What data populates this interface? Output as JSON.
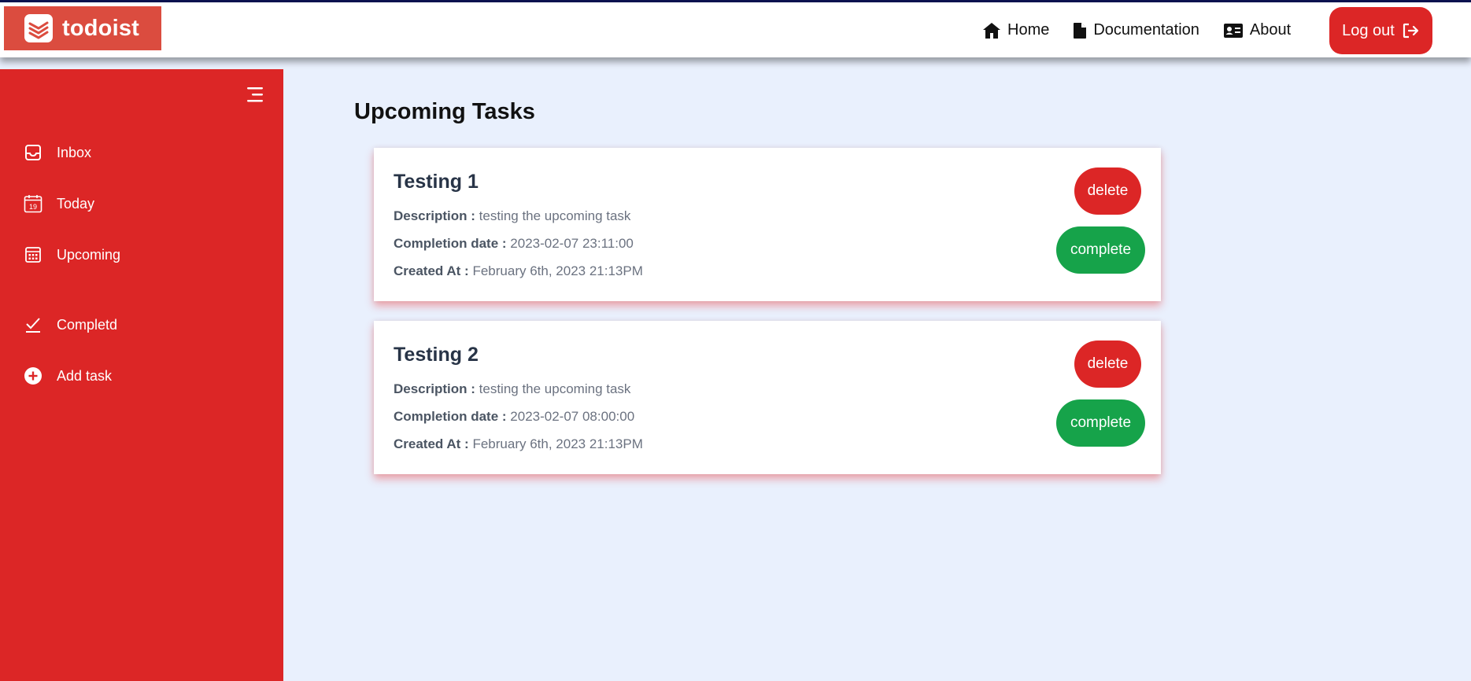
{
  "app": {
    "name": "todoist"
  },
  "nav": {
    "home": "Home",
    "documentation": "Documentation",
    "about": "About",
    "logout": "Log out"
  },
  "sidebar": {
    "items": [
      {
        "label": "Inbox",
        "icon": "inbox-icon"
      },
      {
        "label": "Today",
        "icon": "calendar-today-icon",
        "day": "19"
      },
      {
        "label": "Upcoming",
        "icon": "calendar-upcoming-icon"
      },
      {
        "label": "Completd",
        "icon": "check-icon"
      },
      {
        "label": "Add task",
        "icon": "plus-circle-icon"
      }
    ]
  },
  "main": {
    "title": "Upcoming Tasks",
    "tasks": [
      {
        "title": "Testing 1",
        "description_label": "Description :",
        "description": "testing the upcoming task",
        "completion_label": "Completion date :",
        "completion": "2023-02-07 23:11:00",
        "created_label": "Created At :",
        "created": "February 6th, 2023 21:13PM",
        "delete_label": "delete",
        "complete_label": "complete"
      },
      {
        "title": "Testing 2",
        "description_label": "Description :",
        "description": "testing the upcoming task",
        "completion_label": "Completion date :",
        "completion": "2023-02-07 08:00:00",
        "created_label": "Created At :",
        "created": "February 6th, 2023 21:13PM",
        "delete_label": "delete",
        "complete_label": "complete"
      }
    ]
  },
  "colors": {
    "brand_red": "#dc2626",
    "logo_bg": "#db4c3f",
    "complete_green": "#16a34a",
    "main_bg": "#e9f0fd"
  }
}
